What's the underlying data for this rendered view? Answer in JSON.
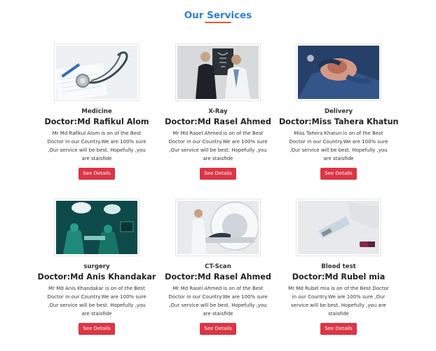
{
  "section": {
    "title": "Our Services"
  },
  "services": [
    {
      "category": "Medicine",
      "doctor": "Doctor:Md Rafikul Alom",
      "description": "Mr Md Rafikul Alom is on of the Best Doctor in our Country.We are 100% sure ,Our service will be best. Hopefully ,you are staisfide",
      "button": "See Details",
      "image": "stethoscope-photo"
    },
    {
      "category": "X-Ray",
      "doctor": "Doctor:Md Rasel Ahmed",
      "description": "Mr Md Rasel Ahmed is on of the Best Doctor in our Country.We are 100% sure ,Our service will be best. Hopefully ,you are staisfide",
      "button": "See Details",
      "image": "xray-doctors-photo"
    },
    {
      "category": "Delivery",
      "doctor": "Doctor:Miss Tahera Khatun",
      "description": "Miss Tahera Khatun is on of the Best Doctor in our Country.We are 100% sure ,Our service will be best. Hopefully ,you are staisfide",
      "button": "See Details",
      "image": "delivery-surgery-photo"
    },
    {
      "category": "surgery",
      "doctor": "Doctor:Md Anis Khandakar",
      "description": "Mr Md Anis Khandakar is on of the Best Doctor in our Country.We are 100% sure ,Our service will be best. Hopefully ,you are staisfide",
      "button": "See Details",
      "image": "operating-room-photo"
    },
    {
      "category": "CT-Scan",
      "doctor": "Doctor:Md Rasel Ahmed",
      "description": "Mr Md Rasel Ahmed is on of the Best Doctor in our Country.We are 100% sure ,Our service will be best. Hopefully ,you are staisfide",
      "button": "See Details",
      "image": "ct-scanner-photo"
    },
    {
      "category": "Blood test",
      "doctor": "Doctor:Md Rubel mia",
      "description": "Mr Md Rubel mia is on of the Best Doctor in our Country.We are 100% sure ,Our service will be best. Hopefully ,you are staisfide",
      "button": "See Details",
      "image": "blood-sample-photo"
    }
  ]
}
